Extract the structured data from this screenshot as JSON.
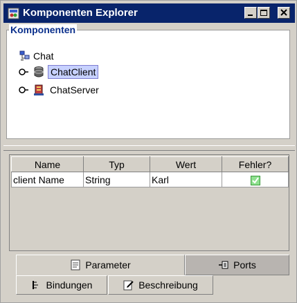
{
  "window": {
    "title": "Komponenten Explorer",
    "colors": {
      "titlebar": "#08246b",
      "face": "#d4d0c8",
      "group_title": "#0a2f8c",
      "selection": "#c7d1ff"
    }
  },
  "titlebar_buttons": [
    "minimize-icon",
    "maximize-icon",
    "close-icon"
  ],
  "components": {
    "group_title": "Komponenten",
    "root": {
      "label": "Chat",
      "icon": "network-icon"
    },
    "children": [
      {
        "label": "ChatClient",
        "icon": "database-icon",
        "selected": true
      },
      {
        "label": "ChatServer",
        "icon": "server-icon",
        "selected": false
      }
    ]
  },
  "table": {
    "headers": [
      "Name",
      "Typ",
      "Wert",
      "Fehler?"
    ],
    "rows": [
      {
        "name": "client Name",
        "type": "String",
        "value": "Karl",
        "error_icon": "checkmark-icon"
      }
    ]
  },
  "tabs": {
    "row1": [
      {
        "label": "Parameter",
        "icon": "document-icon",
        "active": true
      },
      {
        "label": "Ports",
        "icon": "ports-icon",
        "active": false
      }
    ],
    "row2": [
      {
        "label": "Bindungen",
        "icon": "binding-icon"
      },
      {
        "label": "Beschreibung",
        "icon": "edit-icon"
      }
    ]
  }
}
